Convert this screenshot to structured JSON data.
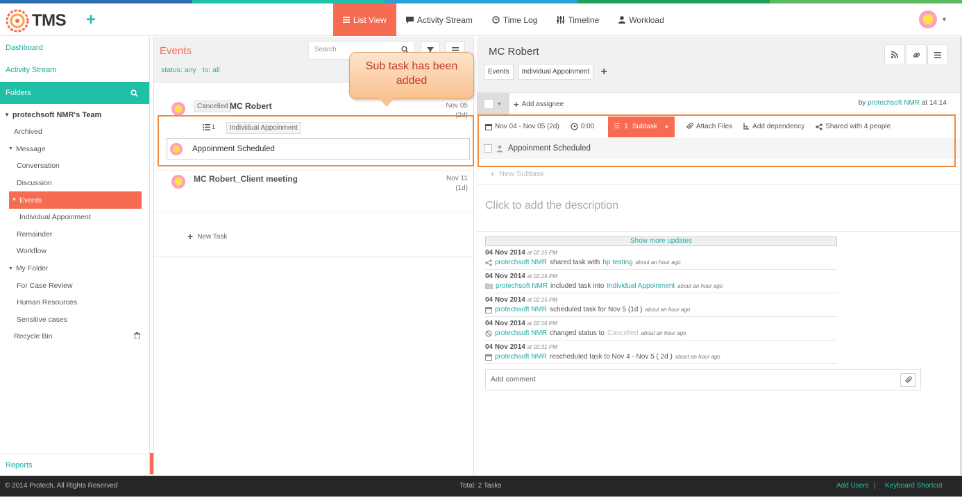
{
  "colors": {
    "accent": "#f76b52",
    "teal": "#1fbfa8",
    "stripe": [
      "#2a6fb0",
      "#1fbfa8",
      "#2a9fd8",
      "#1ea15b",
      "#5cb85c"
    ]
  },
  "app": {
    "logo": "TMS"
  },
  "nav": [
    {
      "label": "List View",
      "icon": "list-icon",
      "active": true
    },
    {
      "label": "Activity Stream",
      "icon": "comment-icon"
    },
    {
      "label": "Time Log",
      "icon": "clock-icon"
    },
    {
      "label": "Timeline",
      "icon": "sliders-icon"
    },
    {
      "label": "Workload",
      "icon": "user-icon"
    }
  ],
  "sidebar": {
    "dashboard": "Dashboard",
    "activity_stream": "Activity Stream",
    "folders": "Folders",
    "team": "protechsoft NMR's Team",
    "items": [
      {
        "label": "Archived",
        "indent": 20
      },
      {
        "label": "Message",
        "indent": 12,
        "caret": true
      },
      {
        "label": "Conversation",
        "indent": 24
      },
      {
        "label": "Discussion",
        "indent": 24
      },
      {
        "label": "Events",
        "indent": 12,
        "caret": true,
        "active": true
      },
      {
        "label": "Individual Appoinment",
        "indent": 28
      },
      {
        "label": "Remainder",
        "indent": 24
      },
      {
        "label": "Workflow",
        "indent": 24
      },
      {
        "label": "My Folder",
        "indent": 12,
        "caret": true
      },
      {
        "label": "For Case Review",
        "indent": 24
      },
      {
        "label": "Human Resources",
        "indent": 24
      },
      {
        "label": "Sensitive cases",
        "indent": 24
      },
      {
        "label": "Recycle Bin",
        "indent": 20,
        "trash": true
      }
    ],
    "reports": "Reports"
  },
  "list": {
    "title": "Events",
    "status_filter": "status: any",
    "to_filter": "to: all",
    "search_placeholder": "Search",
    "task1": {
      "status": "Cancelled",
      "name": "MC Robert",
      "date": "Nov 05",
      "dur": "(2d)",
      "subcount": "1",
      "folder_tag": "Individual Appoinment",
      "subtask": "Appoinment Scheduled"
    },
    "task2": {
      "name": "MC Robert_Client meeting",
      "date": "Nov 11",
      "dur": "(1d)"
    },
    "new_task": "New Task"
  },
  "callout": "Sub task has been added",
  "detail": {
    "title": "MC Robert",
    "tag1": "Events",
    "tag2": "Individual Appoinment",
    "add_assignee": "Add assignee",
    "by_prefix": "by",
    "by_user": "protechsoft NMR",
    "by_time": "at 14:14",
    "date_range": "Nov 04 - Nov 05 (2d)",
    "time": "0:00",
    "subtask_count": "1",
    "subtask_label": "Subtask",
    "attach": "Attach Files",
    "dependency": "Add dependency",
    "shared": "Shared with 4 people",
    "subtask_name": "Appoinment Scheduled",
    "new_subtask": "New Subtask",
    "description_placeholder": "Click to add the description",
    "show_more": "Show more updates",
    "updates": [
      {
        "date": "04 Nov 2014",
        "time": "at 02:15 PM",
        "user": "protechsoft NMR",
        "text": "shared task with",
        "target": "hp testing",
        "tail": "",
        "ago": "about an hour ago",
        "icon": "share-icon"
      },
      {
        "date": "04 Nov 2014",
        "time": "at 02:15 PM",
        "user": "protechsoft NMR",
        "text": "included task into",
        "target": "Individual Appoinment",
        "tail": "",
        "ago": "about an hour ago",
        "icon": "folder-icon"
      },
      {
        "date": "04 Nov 2014",
        "time": "at 02:15 PM",
        "user": "protechsoft NMR",
        "text": "scheduled task for Nov 5 (1d )",
        "target": "",
        "tail": "",
        "ago": "about an hour ago",
        "icon": "calendar-icon"
      },
      {
        "date": "04 Nov 2014",
        "time": "at 02:16 PM",
        "user": "protechsoft NMR",
        "text": "changed status to",
        "target": "Cancelled",
        "tail": "",
        "ago": "about an hour ago",
        "icon": "ban-icon"
      },
      {
        "date": "04 Nov 2014",
        "time": "at 02:31 PM",
        "user": "protechsoft NMR",
        "text": "rescheduled task to Nov 4 - Nov 5 ( 2d )",
        "target": "",
        "tail": "",
        "ago": "about an hour ago",
        "icon": "calendar-icon"
      }
    ],
    "comment_placeholder": "Add comment"
  },
  "footer": {
    "copyright": "© 2014 Protech, All Rights Reserved",
    "total": "Total: 2 Tasks",
    "add_users": "Add Users",
    "separator": "|",
    "shortcut": "Keyboard Shortcut"
  }
}
